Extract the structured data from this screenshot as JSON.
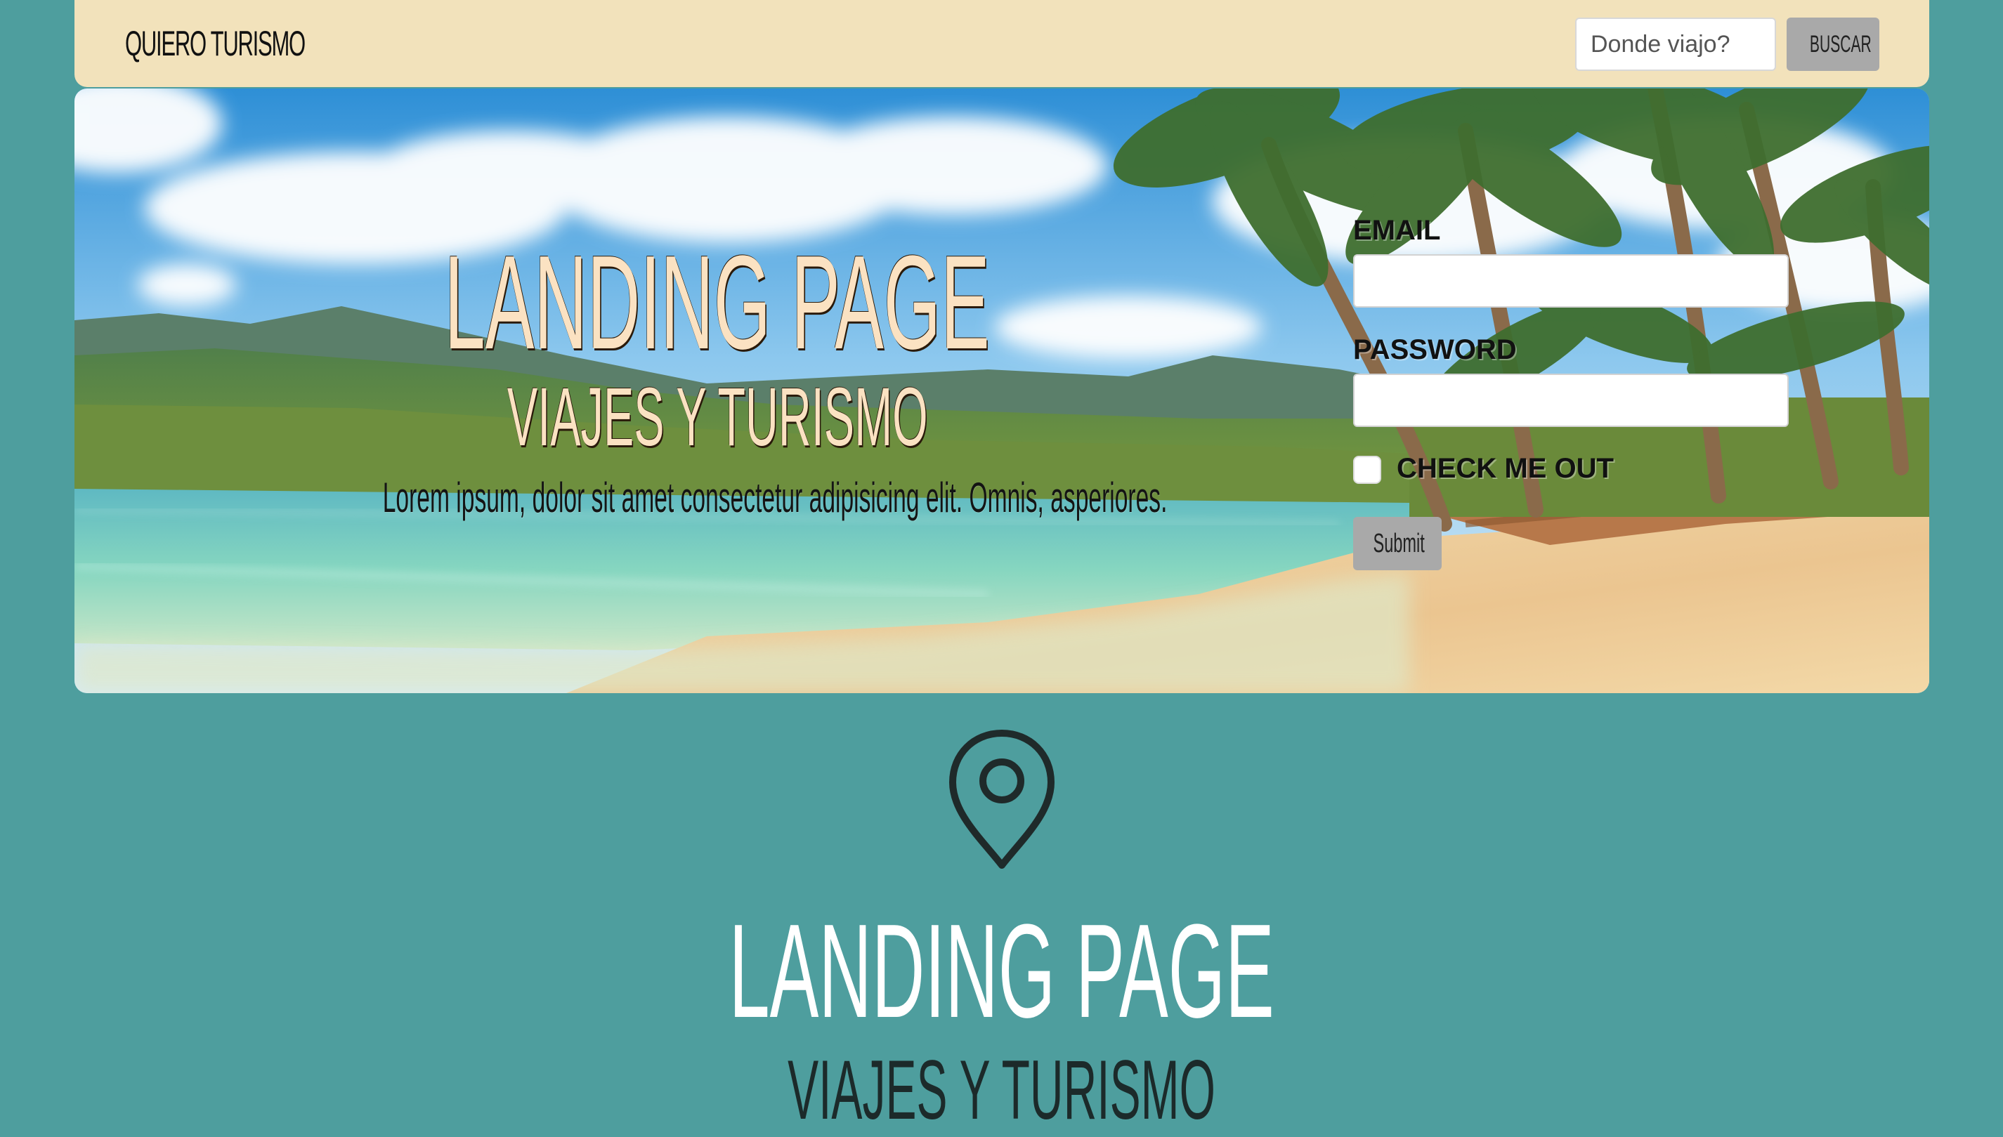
{
  "navbar": {
    "brand": "QUIERO TURISMO",
    "search_placeholder": "Donde viajo?",
    "search_button": "BUSCAR"
  },
  "hero": {
    "title": "LANDING PAGE",
    "subtitle": "VIAJES Y TURISMO",
    "tagline": "Lorem ipsum, dolor sit amet consectetur adipisicing elit. Omnis, asperiores."
  },
  "login_form": {
    "email_label": "EMAIL",
    "email_value": "",
    "password_label": "PASSWORD",
    "password_value": "",
    "check_label": "CHECK ME OUT",
    "checked": false,
    "submit_label": "Submit"
  },
  "section": {
    "icon": "map-pin-icon",
    "title": "LANDING PAGE",
    "subtitle": "VIAJES Y TURISMO"
  },
  "colors": {
    "page_background": "#4e9e9e",
    "navbar_background": "#f2e2bb",
    "button_background": "#a9a9a9",
    "hero_title": "#fbe2c2"
  }
}
